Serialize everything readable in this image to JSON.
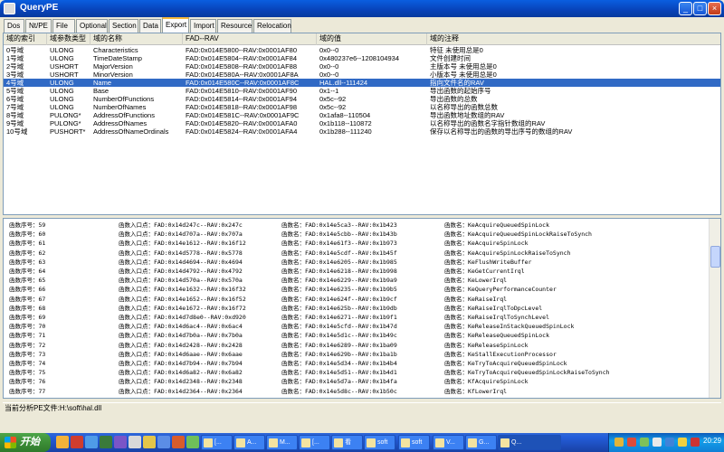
{
  "window": {
    "title": "QueryPE",
    "minimize_glyph": "_",
    "maximize_glyph": "□",
    "close_glyph": "×"
  },
  "tabs": [
    "Dos",
    "Nt/PE",
    "File",
    "Optional",
    "Section",
    "Data",
    "Export",
    "Import",
    "Resource",
    "Relocation"
  ],
  "active_tab": "Export",
  "export_table": {
    "headers": [
      "域的索引",
      "域参数类型",
      "域的名称",
      "FAD--RAV",
      "域的值",
      "域的注释"
    ],
    "selected_index": 4,
    "rows": [
      [
        "0号域",
        "ULONG",
        "Characteristics",
        "FAD:0x014E5800--RAV:0x0001AF80",
        "0x0--0",
        "特征 未使用总是0"
      ],
      [
        "1号域",
        "ULONG",
        "TimeDateStamp",
        "FAD:0x014E5804--RAV:0x0001AF84",
        "0x480237e6--1208104934",
        "文件创建时间"
      ],
      [
        "2号域",
        "USHORT",
        "MajorVersion",
        "FAD:0x014E5808--RAV:0x0001AF88",
        "0x0--0",
        "主版本号 未使用总是0"
      ],
      [
        "3号域",
        "USHORT",
        "MinorVersion",
        "FAD:0x014E580A--RAV:0x0001AF8A",
        "0x0--0",
        "小版本号 未使用总是0"
      ],
      [
        "4号域",
        "ULONG",
        "Name",
        "FAD:0x014E580C--RAV:0x0001AF8C",
        "HAL.dll--111424",
        "指向文件名的RAV"
      ],
      [
        "5号域",
        "ULONG",
        "Base",
        "FAD:0x014E5810--RAV:0x0001AF90",
        "0x1--1",
        "导出函数的起始序号"
      ],
      [
        "6号域",
        "ULONG",
        "NumberOfFunctions",
        "FAD:0x014E5814--RAV:0x0001AF94",
        "0x5c--92",
        "导出函数的总数"
      ],
      [
        "7号域",
        "ULONG",
        "NumberOfNames",
        "FAD:0x014E5818--RAV:0x0001AF98",
        "0x5c--92",
        "以名称导出的函数总数"
      ],
      [
        "8号域",
        "PULONG*",
        "AddressOfFunctions",
        "FAD:0x014E581C--RAV:0x0001AF9C",
        "0x1afa8--110504",
        "导出函数地址数组的RAV"
      ],
      [
        "9号域",
        "PULONG*",
        "AddressOfNames",
        "FAD:0x014E5820--RAV:0x0001AFA0",
        "0x1b118--110872",
        "以名称导出的函数名字指针数组的RAV"
      ],
      [
        "10号域",
        "PUSHORT*",
        "AddressOfNameOrdinals",
        "FAD:0x014E5824--RAV:0x0001AFA4",
        "0x1b288--111240",
        "保存以名称导出的函数的导出序号的数组的RAV"
      ]
    ]
  },
  "log": {
    "lines": [
      [
        "函数序号：59",
        "函数入口点：FAD:0x14d247c--RAV:0x247c",
        "函数名：FAD:0x14e5ca3--RAV:0x1b423",
        "函数名：KeAcquireQueuedSpinLock"
      ],
      [
        "函数序号：60",
        "函数入口点：FAD:0x14d707a--RAV:0x707a",
        "函数名：FAD:0x14e5cbb--RAV:0x1b43b",
        "函数名：KeAcquireQueuedSpinLockRaiseToSynch"
      ],
      [
        "函数序号：61",
        "函数入口点：FAD:0x14e1612--RAV:0x16f12",
        "函数名：FAD:0x14e61f3--RAV:0x1b973",
        "函数名：KeAcquireSpinLock"
      ],
      [
        "函数序号：62",
        "函数入口点：FAD:0x14d5778--RAV:0x5778",
        "函数名：FAD:0x14e5cdf--RAV:0x1b45f",
        "函数名：KeAcquireSpinLockRaiseToSynch"
      ],
      [
        "函数序号：63",
        "函数入口点：FAD:0x14d4694--RAV:0x4694",
        "函数名：FAD:0x14e6205--RAV:0x1b985",
        "函数名：KeFlushWriteBuffer"
      ],
      [
        "函数序号：64",
        "函数入口点：FAD:0x14d4792--RAV:0x4792",
        "函数名：FAD:0x14e6218--RAV:0x1b998",
        "函数名：KeGetCurrentIrql"
      ],
      [
        "函数序号：65",
        "函数入口点：FAD:0x14d570a--RAV:0x570a",
        "函数名：FAD:0x14e6229--RAV:0x1b9a9",
        "函数名：KeLowerIrql"
      ],
      [
        "函数序号：66",
        "函数入口点：FAD:0x14e1632--RAV:0x16f32",
        "函数名：FAD:0x14e6235--RAV:0x1b9b5",
        "函数名：KeQueryPerformanceCounter"
      ],
      [
        "函数序号：67",
        "函数入口点：FAD:0x14e1652--RAV:0x16f52",
        "函数名：FAD:0x14e624f--RAV:0x1b9cf",
        "函数名：KeRaiseIrql"
      ],
      [
        "函数序号：68",
        "函数入口点：FAD:0x14e1672--RAV:0x16f72",
        "函数名：FAD:0x14e625b--RAV:0x1b9db",
        "函数名：KeRaiseIrqlToDpcLevel"
      ],
      [
        "函数序号：69",
        "函数入口点：FAD:0x14d7d8e0--RAV:0xd920",
        "函数名：FAD:0x14e6271--RAV:0x1b9f1",
        "函数名：KeRaiseIrqlToSynchLevel"
      ],
      [
        "函数序号：70",
        "函数入口点：FAD:0x14d6ac4--RAV:0x6ac4",
        "函数名：FAD:0x14e5cfd--RAV:0x1b47d",
        "函数名：KeReleaseInStackQueuedSpinLock"
      ],
      [
        "函数序号：71",
        "函数入口点：FAD:0x14d7b0a--RAV:0x7b0a",
        "函数名：FAD:0x14e5d1c--RAV:0x1b49c",
        "函数名：KeReleaseQueuedSpinLock"
      ],
      [
        "函数序号：72",
        "函数入口点：FAD:0x14d2428--RAV:0x2428",
        "函数名：FAD:0x14e6289--RAV:0x1ba09",
        "函数名：KeReleaseSpinLock"
      ],
      [
        "函数序号：73",
        "函数入口点：FAD:0x14d6aae--RAV:0x6aae",
        "函数名：FAD:0x14e629b--RAV:0x1ba1b",
        "函数名：KeStallExecutionProcessor"
      ],
      [
        "函数序号：74",
        "函数入口点：FAD:0x14d7b94--RAV:0x7b94",
        "函数名：FAD:0x14e5d34--RAV:0x1b4b4",
        "函数名：KeTryToAcquireQueuedSpinLock"
      ],
      [
        "函数序号：75",
        "函数入口点：FAD:0x14d6a82--RAV:0x6a82",
        "函数名：FAD:0x14e5d51--RAV:0x1b4d1",
        "函数名：KeTryToAcquireQueuedSpinLockRaiseToSynch"
      ],
      [
        "函数序号：76",
        "函数入口点：FAD:0x14d2348--RAV:0x2348",
        "函数名：FAD:0x14e5d7a--RAV:0x1b4fa",
        "函数名：KfAcquireSpinLock"
      ],
      [
        "函数序号：77",
        "函数入口点：FAD:0x14d2364--RAV:0x2364",
        "函数名：FAD:0x14e5d8c--RAV:0x1b50c",
        "函数名：KfLowerIrql"
      ]
    ]
  },
  "status": "当前分析PE文件:H:\\soft\\hal.dll",
  "taskbar": {
    "start_label": "开始",
    "tasks": [
      "[...",
      "A...",
      "M...",
      "[...",
      "看",
      "soft",
      "soft",
      "V...",
      "G...",
      "Q..."
    ],
    "active_task_index": 9,
    "clock": "20:29"
  },
  "colors": {
    "selection": "#316ac5",
    "titlebar": "#0842b8",
    "taskbar": "#245edb",
    "start": "#3c8e37"
  }
}
